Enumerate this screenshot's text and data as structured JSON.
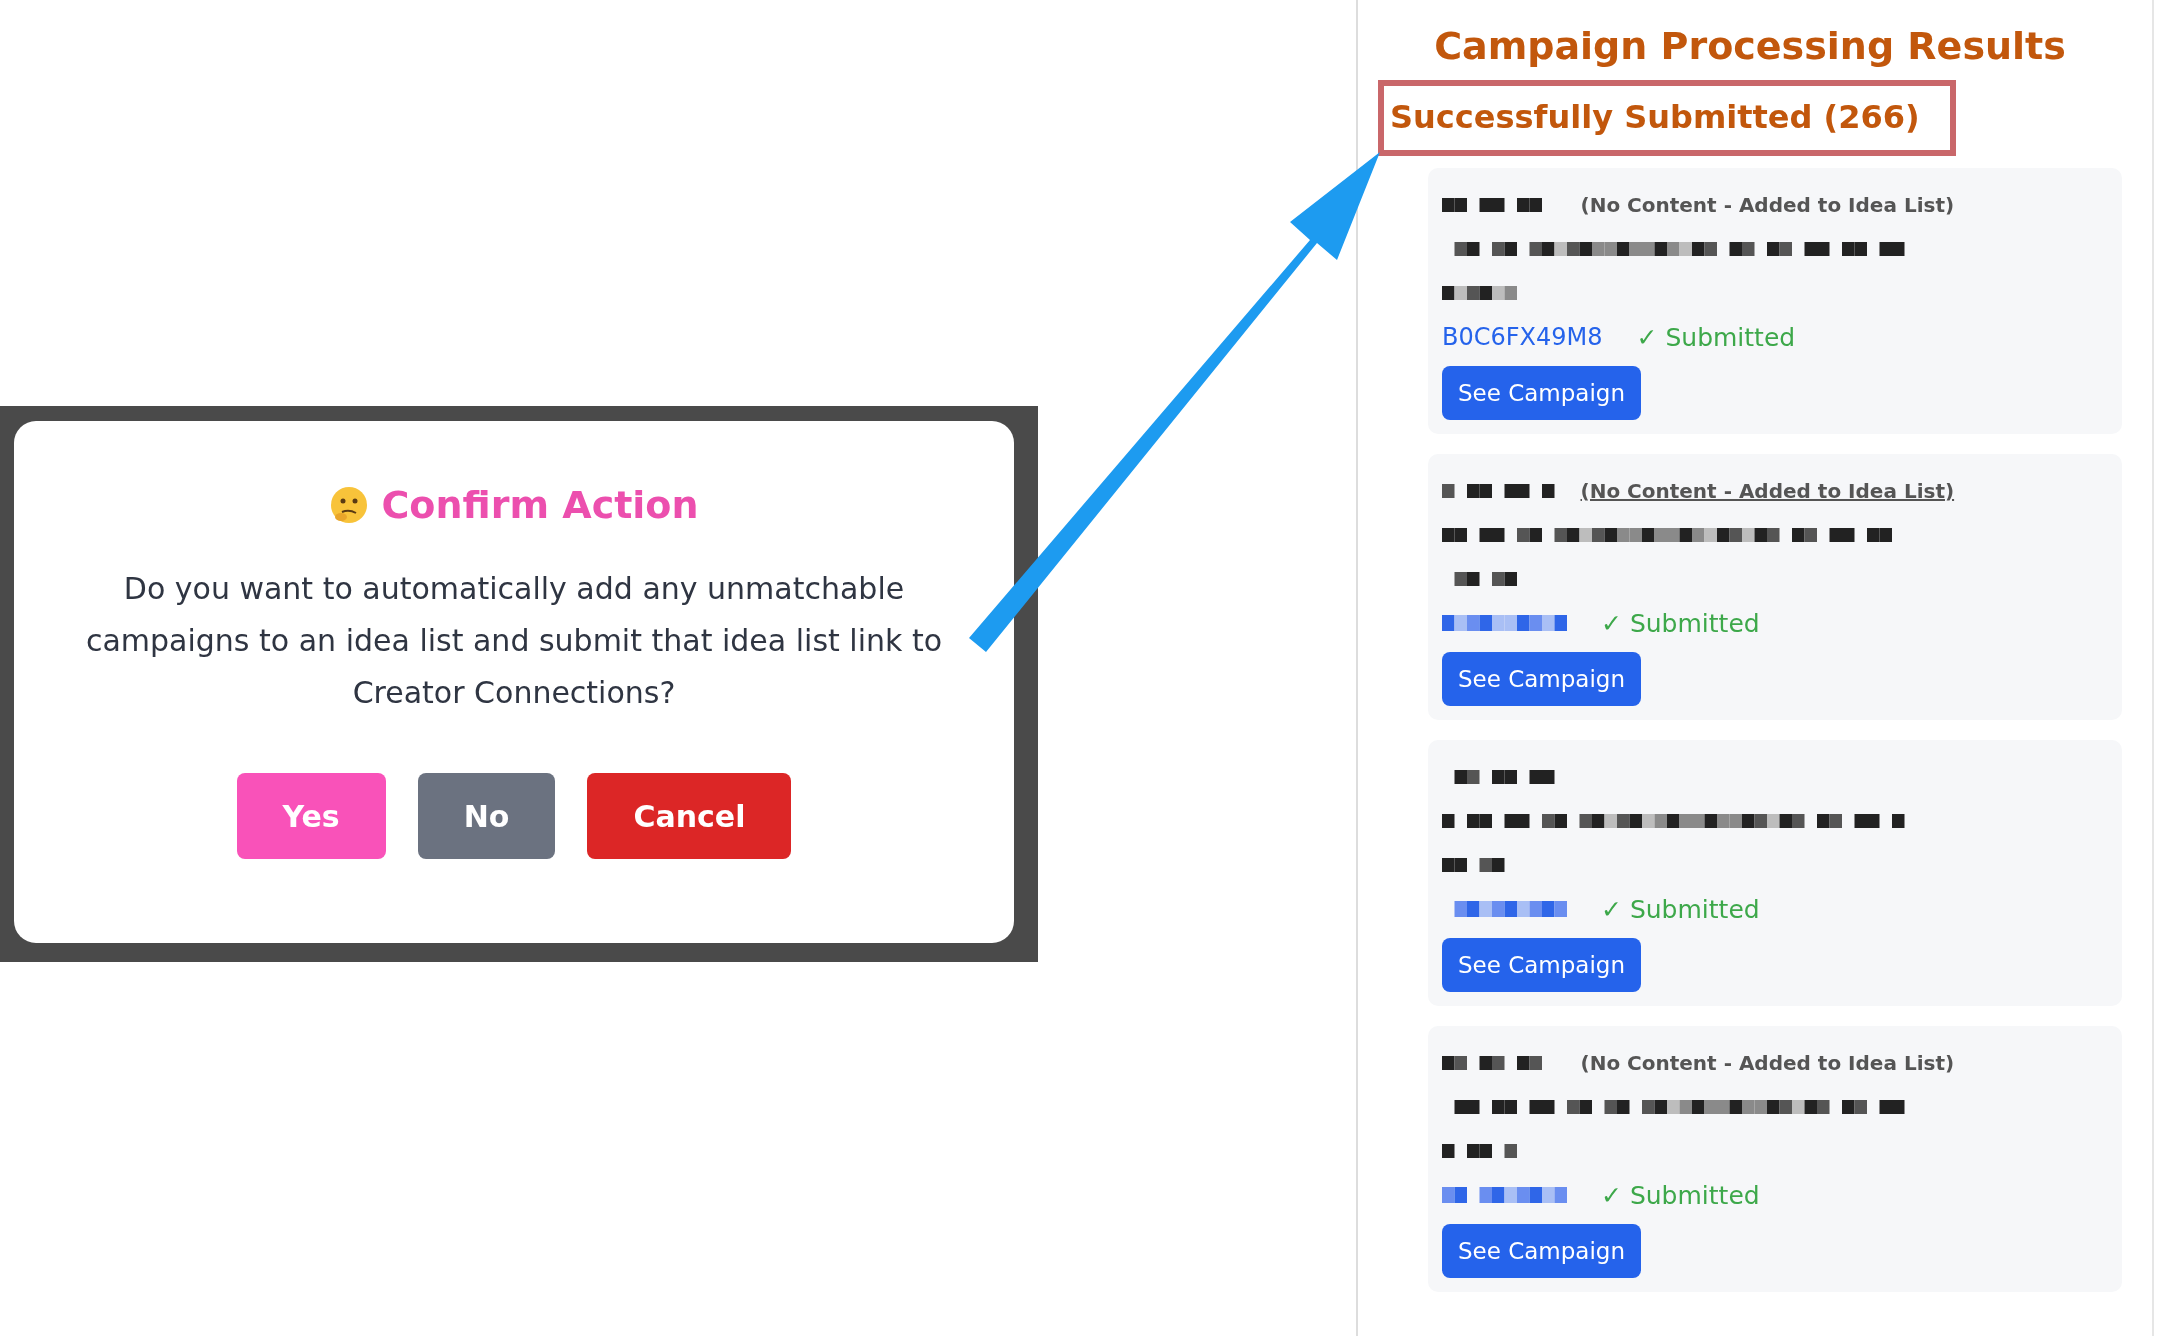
{
  "dialog": {
    "title": "Confirm Action",
    "message": "Do you want to automatically add any unmatchable campaigns to an idea list and submit that idea list link to Creator Connections?",
    "buttons": [
      {
        "label": "Yes",
        "kind": "confirm"
      },
      {
        "label": "No",
        "kind": "decline"
      },
      {
        "label": "Cancel",
        "kind": "cancel"
      }
    ]
  },
  "results": {
    "title": "Campaign Processing Results",
    "section": {
      "heading": "Successfully Submitted (266)",
      "highlighted": true
    },
    "items": [
      {
        "note": "(No Content - Added to Idea List)",
        "hovered": false,
        "asin": "B0C6FX49M8",
        "status": "✓ Submitted",
        "button": "See Campaign"
      },
      {
        "note": "(No Content - Added to Idea List)",
        "hovered": true,
        "status": "✓ Submitted",
        "button": "See Campaign"
      },
      {
        "status": "✓ Submitted",
        "button": "See Campaign"
      },
      {
        "note": "(No Content - Added to Idea List)",
        "hovered": false,
        "status": "✓ Submitted",
        "button": "See Campaign"
      }
    ]
  }
}
